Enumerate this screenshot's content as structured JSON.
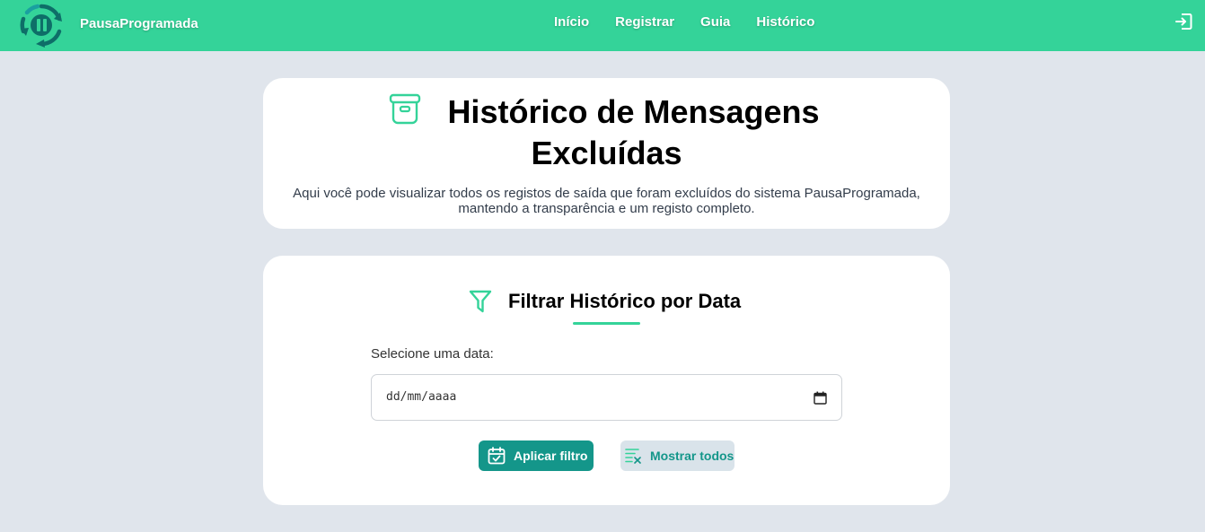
{
  "navbar": {
    "brand_name": "PausaProgramada",
    "logo_icon": "pause-cycle-logo",
    "links": [
      "Início",
      "Registrar",
      "Guia",
      "Histórico"
    ],
    "logout_icon": "logout-icon"
  },
  "header": {
    "icon": "archive-icon",
    "title_line1": "Histórico de Mensagens",
    "title_line2": "Excluídas",
    "subtitle_line1": "Aqui você pode visualizar todos os registos de saída que foram excluídos do sistema PausaProgramada,",
    "subtitle_line2": "mantendo a transparência e um registo completo."
  },
  "filter": {
    "icon": "filter-icon",
    "title": "Filtrar Histórico por Data",
    "date_label": "Selecione uma data:",
    "date_placeholder": "dd/mm/aaaa",
    "apply_label": "Aplicar filtro",
    "show_all_label": "Mostrar todos"
  },
  "colors": {
    "accent": "#34d399",
    "primary_button": "#14968a",
    "secondary_button_bg": "#d9e3ea",
    "page_bg": "#e0e5ec"
  }
}
